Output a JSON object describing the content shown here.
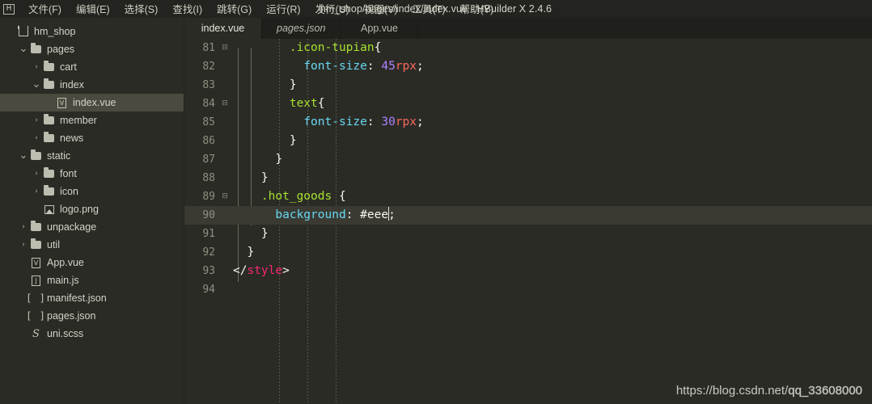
{
  "window": {
    "title": "hm_shop/pages/index/index.vue - HBuilder X 2.4.6",
    "app_icon": "H"
  },
  "menubar": {
    "items": [
      {
        "label": "文件(F)",
        "name": "menu-file"
      },
      {
        "label": "编辑(E)",
        "name": "menu-edit"
      },
      {
        "label": "选择(S)",
        "name": "menu-select"
      },
      {
        "label": "查找(I)",
        "name": "menu-find"
      },
      {
        "label": "跳转(G)",
        "name": "menu-goto"
      },
      {
        "label": "运行(R)",
        "name": "menu-run"
      },
      {
        "label": "发行(U)",
        "name": "menu-publish"
      },
      {
        "label": "视图(V)",
        "name": "menu-view"
      },
      {
        "label": "工具(T)",
        "name": "menu-tools"
      },
      {
        "label": "帮助(Y)",
        "name": "menu-help"
      }
    ]
  },
  "sidebar": {
    "items": [
      {
        "label": "hm_shop",
        "depth": 0,
        "arrow": "",
        "icon": "root",
        "selected": false
      },
      {
        "label": "pages",
        "depth": 1,
        "arrow": "v",
        "icon": "folder",
        "selected": false
      },
      {
        "label": "cart",
        "depth": 2,
        "arrow": ">",
        "icon": "folder",
        "selected": false
      },
      {
        "label": "index",
        "depth": 2,
        "arrow": "v",
        "icon": "folder",
        "selected": false
      },
      {
        "label": "index.vue",
        "depth": 3,
        "arrow": "",
        "icon": "vue",
        "selected": true
      },
      {
        "label": "member",
        "depth": 2,
        "arrow": ">",
        "icon": "folder",
        "selected": false
      },
      {
        "label": "news",
        "depth": 2,
        "arrow": ">",
        "icon": "folder",
        "selected": false
      },
      {
        "label": "static",
        "depth": 1,
        "arrow": "v",
        "icon": "folder",
        "selected": false
      },
      {
        "label": "font",
        "depth": 2,
        "arrow": ">",
        "icon": "folder",
        "selected": false
      },
      {
        "label": "icon",
        "depth": 2,
        "arrow": ">",
        "icon": "folder",
        "selected": false
      },
      {
        "label": "logo.png",
        "depth": 2,
        "arrow": "",
        "icon": "image",
        "selected": false
      },
      {
        "label": "unpackage",
        "depth": 1,
        "arrow": ">",
        "icon": "folder",
        "selected": false
      },
      {
        "label": "util",
        "depth": 1,
        "arrow": ">",
        "icon": "folder",
        "selected": false
      },
      {
        "label": "App.vue",
        "depth": 1,
        "arrow": "",
        "icon": "vue",
        "selected": false
      },
      {
        "label": "main.js",
        "depth": 1,
        "arrow": "",
        "icon": "js",
        "selected": false
      },
      {
        "label": "manifest.json",
        "depth": 1,
        "arrow": "",
        "icon": "json",
        "selected": false
      },
      {
        "label": "pages.json",
        "depth": 1,
        "arrow": "",
        "icon": "json",
        "selected": false
      },
      {
        "label": "uni.scss",
        "depth": 1,
        "arrow": "",
        "icon": "scss",
        "selected": false
      }
    ]
  },
  "tabs": [
    {
      "label": "index.vue",
      "active": true,
      "preview": false
    },
    {
      "label": "pages.json",
      "active": false,
      "preview": true
    },
    {
      "label": "App.vue",
      "active": false,
      "preview": false
    }
  ],
  "editor": {
    "language": "vue",
    "cursor_line": 90,
    "lines": [
      {
        "num": "81",
        "fold": "-",
        "active": false,
        "indent": 4,
        "tokens": [
          {
            "t": ".icon-tupian",
            "c": "sel"
          },
          {
            "t": "{",
            "c": "punc"
          }
        ]
      },
      {
        "num": "82",
        "fold": "",
        "active": false,
        "indent": 5,
        "tokens": [
          {
            "t": "font-size",
            "c": "prop"
          },
          {
            "t": ": ",
            "c": "punc"
          },
          {
            "t": "45",
            "c": "num"
          },
          {
            "t": "rpx",
            "c": "unit"
          },
          {
            "t": ";",
            "c": "punc"
          }
        ]
      },
      {
        "num": "83",
        "fold": "",
        "active": false,
        "indent": 4,
        "tokens": [
          {
            "t": "}",
            "c": "punc"
          }
        ]
      },
      {
        "num": "84",
        "fold": "-",
        "active": false,
        "indent": 4,
        "tokens": [
          {
            "t": "text",
            "c": "sel"
          },
          {
            "t": "{",
            "c": "punc"
          }
        ]
      },
      {
        "num": "85",
        "fold": "",
        "active": false,
        "indent": 5,
        "tokens": [
          {
            "t": "font-size",
            "c": "prop"
          },
          {
            "t": ": ",
            "c": "punc"
          },
          {
            "t": "30",
            "c": "num"
          },
          {
            "t": "rpx",
            "c": "unit"
          },
          {
            "t": ";",
            "c": "punc"
          }
        ]
      },
      {
        "num": "86",
        "fold": "",
        "active": false,
        "indent": 4,
        "tokens": [
          {
            "t": "}",
            "c": "punc"
          }
        ]
      },
      {
        "num": "87",
        "fold": "",
        "active": false,
        "indent": 3,
        "tokens": [
          {
            "t": "}",
            "c": "punc"
          }
        ]
      },
      {
        "num": "88",
        "fold": "",
        "active": false,
        "indent": 2,
        "tokens": [
          {
            "t": "}",
            "c": "punc"
          }
        ]
      },
      {
        "num": "89",
        "fold": "-",
        "active": false,
        "indent": 2,
        "tokens": [
          {
            "t": ".hot_goods",
            "c": "sel"
          },
          {
            "t": " {",
            "c": "punc"
          }
        ]
      },
      {
        "num": "90",
        "fold": "",
        "active": true,
        "indent": 3,
        "tokens": [
          {
            "t": "background",
            "c": "prop"
          },
          {
            "t": ": ",
            "c": "punc"
          },
          {
            "t": "#eee",
            "c": "val"
          },
          {
            "t": "|caret|",
            "c": "caret"
          },
          {
            "t": ";",
            "c": "punc"
          }
        ]
      },
      {
        "num": "91",
        "fold": "",
        "active": false,
        "indent": 2,
        "tokens": [
          {
            "t": "}",
            "c": "punc"
          }
        ]
      },
      {
        "num": "92",
        "fold": "",
        "active": false,
        "indent": 1,
        "tokens": [
          {
            "t": "}",
            "c": "punc"
          }
        ]
      },
      {
        "num": "93",
        "fold": "",
        "active": false,
        "indent": 0,
        "tokens": [
          {
            "t": "</",
            "c": "punc"
          },
          {
            "t": "style",
            "c": "tag"
          },
          {
            "t": ">",
            "c": "punc"
          }
        ]
      },
      {
        "num": "94",
        "fold": "",
        "active": false,
        "indent": 0,
        "tokens": []
      }
    ]
  },
  "watermark": {
    "text": "https://blog.csdn.net/qq_33608000",
    "ghost": "qq_33608000"
  },
  "colors": {
    "background": "#2b2b26",
    "titlebar": "#23231f",
    "tabbar": "#1f1f1c",
    "selection": "#4a4a3e",
    "active_line": "#3a3a33",
    "selector": "#a6e22e",
    "property": "#66d9ef",
    "number": "#ae81ff",
    "unit": "#f9695f",
    "tag": "#f92672",
    "text": "#f4f4ec"
  }
}
